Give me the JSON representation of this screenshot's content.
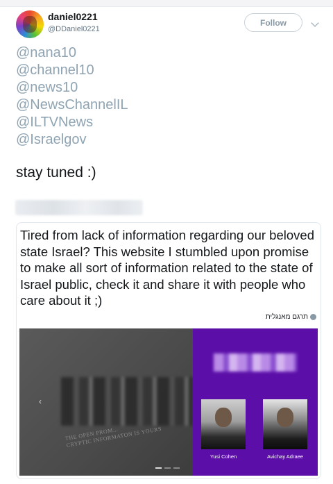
{
  "tweet": {
    "display_name": "daniel0221",
    "handle": "@DDaniel0221",
    "follow_label": "Follow",
    "mentions": [
      "@nana10",
      "@channel10",
      "@news10",
      "@NewsChannelIL",
      "@ILTVNews",
      "@Israelgov"
    ],
    "message": "stay tuned :)"
  },
  "quoted": {
    "text": "Tired from lack of information regarding our beloved state Israel? This website I stumbled upon promise to make all sort of information related to the state of Israel public, check it and share it with people who care about it ;)",
    "translate_label": "תרגם מאנגלית",
    "preview": {
      "tagline_1": "THE OPEN PROM...",
      "tagline_2": "CRYPTIC INFORMATON IS YOURS",
      "people": [
        {
          "name": "Yusi Cohen"
        },
        {
          "name": "Avichay Adraee"
        }
      ]
    }
  },
  "colors": {
    "purple_panel": "#5b0fa8",
    "mention": "#8fa4b3",
    "muted": "#657786"
  }
}
